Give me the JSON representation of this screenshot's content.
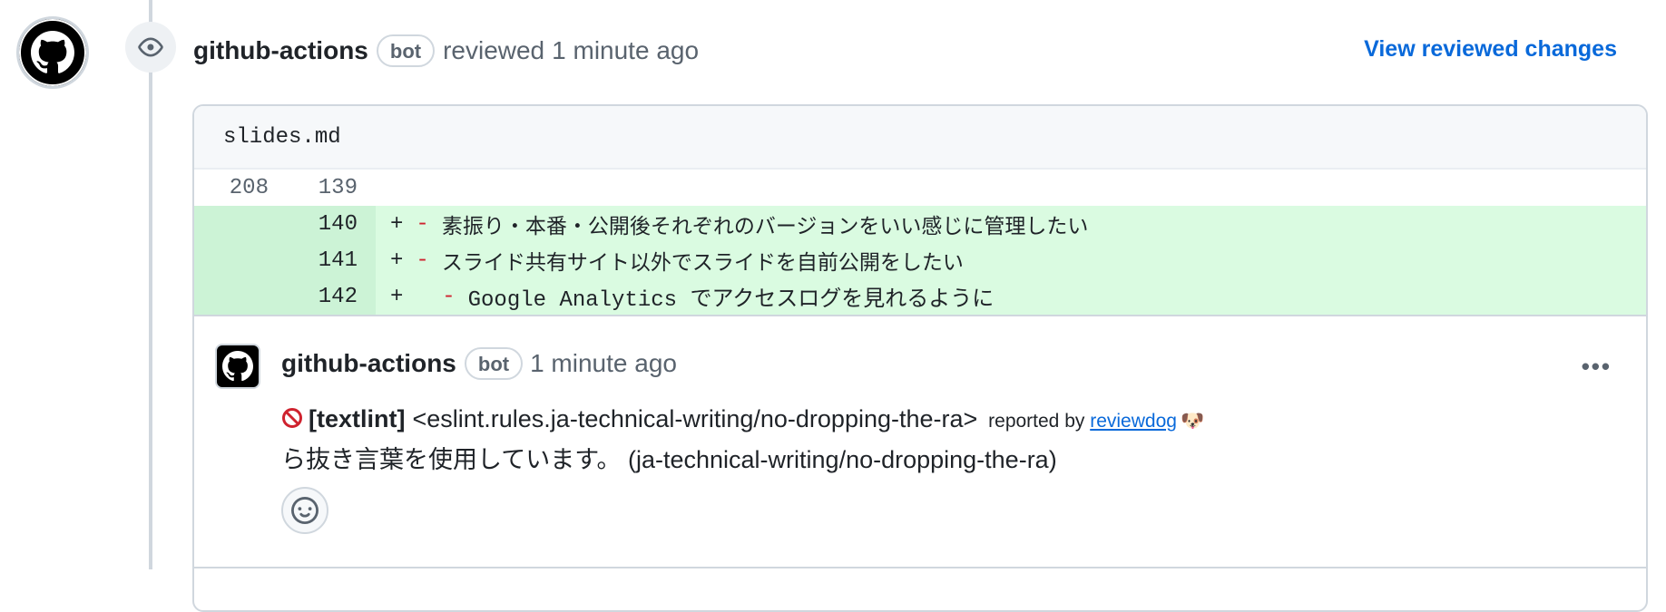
{
  "review": {
    "author": "github-actions",
    "bot_label": "bot",
    "action": "reviewed",
    "time": "1 minute ago",
    "view_changes_link": "View reviewed changes"
  },
  "file": {
    "name": "slides.md"
  },
  "diff_lines": [
    {
      "old": "208",
      "new": "139",
      "type": "context",
      "marker": "",
      "dash": "",
      "text": ""
    },
    {
      "old": "",
      "new": "140",
      "type": "added",
      "marker": "+",
      "dash": "-",
      "text": "素振り・本番・公開後それぞれのバージョンをいい感じに管理したい"
    },
    {
      "old": "",
      "new": "141",
      "type": "added",
      "marker": "+",
      "dash": "-",
      "text": "スライド共有サイト以外でスライドを自前公開をしたい"
    },
    {
      "old": "",
      "new": "142",
      "type": "added",
      "marker": "+",
      "dash": "  -",
      "text": "Google Analytics でアクセスログを見れるように"
    }
  ],
  "comment": {
    "author": "github-actions",
    "bot_label": "bot",
    "time": "1 minute ago",
    "more_label": "•••",
    "tag": "[textlint]",
    "rule": "<eslint.rules.ja-technical-writing/no-dropping-the-ra>",
    "reported_by": "reported by",
    "reviewdog_link": "reviewdog",
    "dog_emoji": "🐶",
    "message": "ら抜き言葉を使用しています。 (ja-technical-writing/no-dropping-the-ra)"
  },
  "colors": {
    "added_bg": "#dafbe1",
    "added_gutter_bg": "#ccf3d6",
    "link": "#0969da",
    "dash": "#cf222e",
    "prohibited": "#cf222e"
  },
  "icons": {
    "timeline": "eye-icon",
    "avatar": "github-octocat-icon",
    "more": "kebab-horizontal-icon",
    "reaction": "smiley-icon",
    "status": "prohibited-icon"
  }
}
